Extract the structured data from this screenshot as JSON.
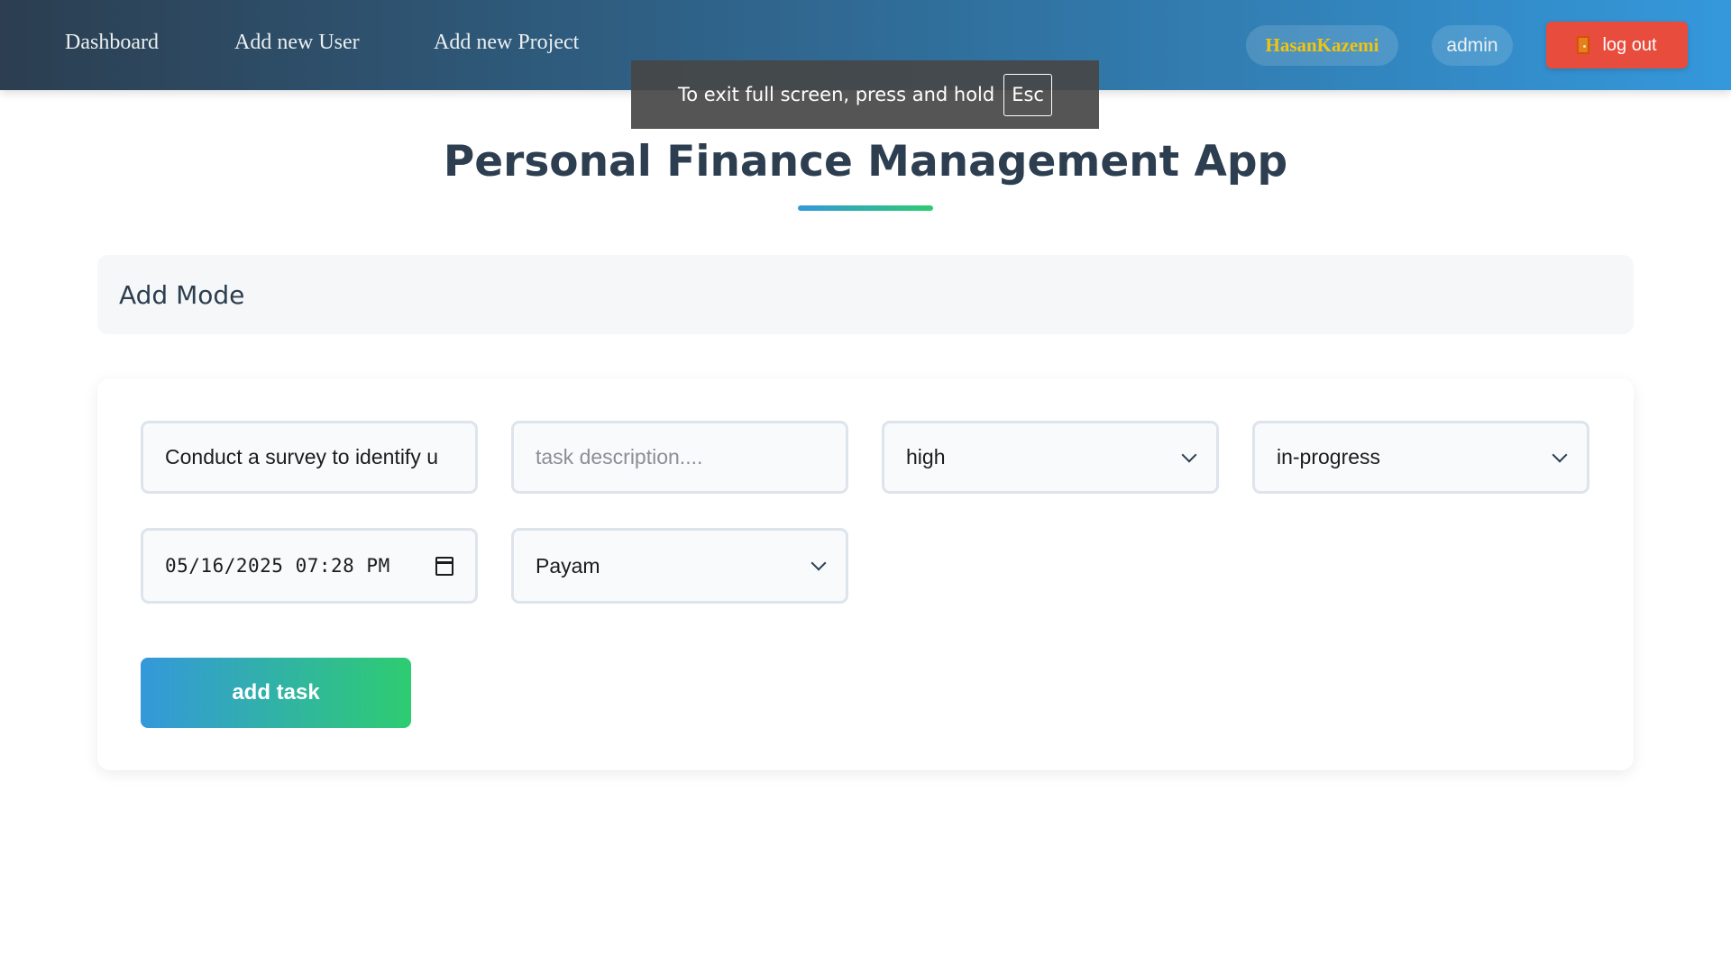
{
  "nav": {
    "links": [
      "Dashboard",
      "Add new User",
      "Add new Project"
    ],
    "username": "HasanKazemi",
    "role": "admin",
    "logout_label": "log out",
    "logout_icon": "door-icon"
  },
  "fullscreen_notice": {
    "text": "To exit full screen, press and hold",
    "key": "Esc"
  },
  "page": {
    "title": "Personal Finance Management App",
    "mode_title": "Add Mode"
  },
  "form": {
    "title_value": "Conduct a survey to identify u",
    "description_placeholder": "task description....",
    "priority_value": "high",
    "status_value": "in-progress",
    "datetime_value": "05/16/2025 07:28 PM",
    "assignee_value": "Payam",
    "submit_label": "add task"
  },
  "colors": {
    "nav_gradient_start": "#2c3e50",
    "nav_gradient_end": "#3498db",
    "logout": "#e74c3c",
    "username": "#f1c40f",
    "button_gradient_start": "#3498db",
    "button_gradient_end": "#2ecc71"
  }
}
